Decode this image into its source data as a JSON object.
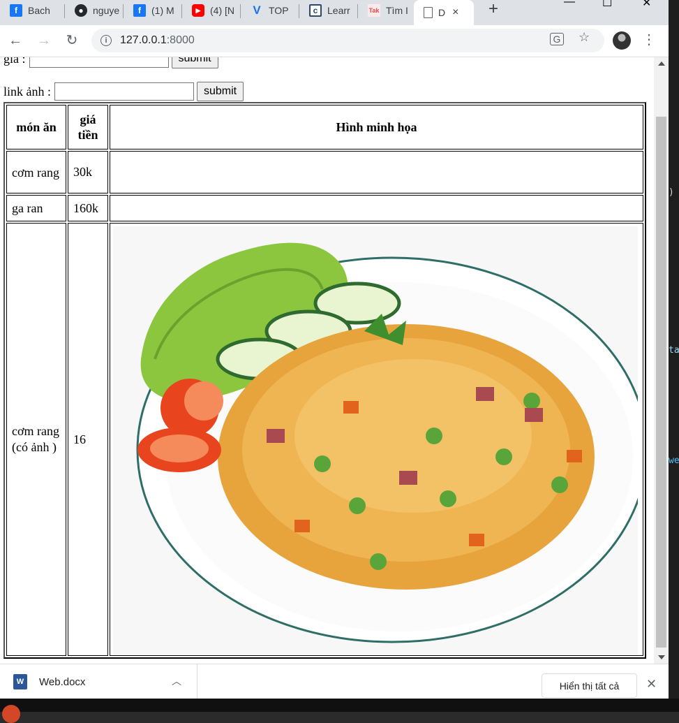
{
  "browser": {
    "tabs": [
      {
        "label": "Bach",
        "icon": "facebook-icon",
        "color": "#1877f2",
        "glyph": "f"
      },
      {
        "label": "nguye",
        "icon": "github-icon",
        "color": "#24292e",
        "glyph": "●"
      },
      {
        "label": "(1) M",
        "icon": "facebook-icon",
        "color": "#1877f2",
        "glyph": "f"
      },
      {
        "label": "(4) [N",
        "icon": "youtube-icon",
        "color": "#ff0000",
        "glyph": "▶"
      },
      {
        "label": "TOP",
        "icon": "v-logo-icon",
        "color": "#1a73e8",
        "glyph": "V"
      },
      {
        "label": "Learr",
        "icon": "c-logo-icon",
        "color": "#2c4a6e",
        "glyph": "c"
      },
      {
        "label": "Tìm I",
        "icon": "tak-logo-icon",
        "color": "#e54b4b",
        "glyph": "T"
      },
      {
        "label": "D",
        "icon": "page-icon",
        "color": "#5f6368",
        "glyph": ""
      }
    ],
    "active_tab_close": "×",
    "new_tab": "+",
    "window_controls": {
      "minimize": "—",
      "maximize": "☐",
      "close": "✕"
    },
    "url_host": "127.0.0.1",
    "url_port": ":8000"
  },
  "form": {
    "price_label": "giá :",
    "price_value": "",
    "price_submit": "submit",
    "image_label": "link ảnh :",
    "image_value": "",
    "image_submit": "submit"
  },
  "table": {
    "headers": {
      "dish": "món ăn",
      "price": "giá tiền",
      "image": "Hình minh họa"
    },
    "rows": [
      {
        "dish": "cơm rang",
        "price": "30k"
      },
      {
        "dish": "ga ran",
        "price": "160k"
      },
      {
        "dish": "cơm rang (có ảnh )",
        "price": "16"
      }
    ]
  },
  "downloads": {
    "file_name": "Web.docx",
    "file_icon_text": "W",
    "show_all": "Hiển thị tất cả",
    "close": "✕"
  },
  "right_strip_glyphs": [
    ")",
    "ta",
    "we"
  ]
}
